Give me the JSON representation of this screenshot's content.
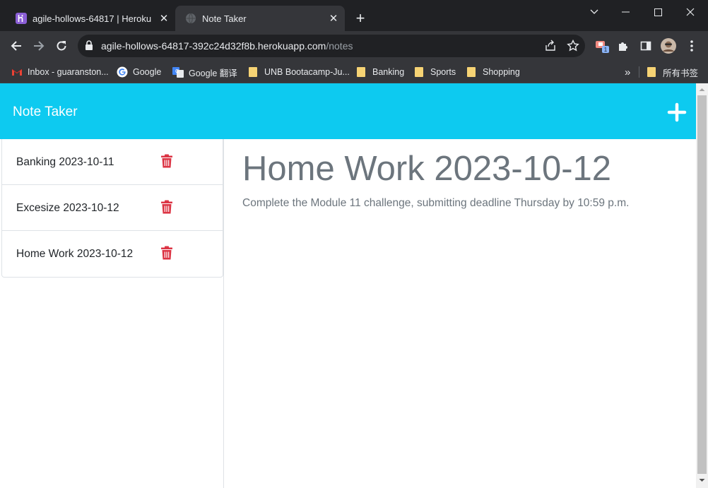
{
  "browser": {
    "tabs": [
      {
        "title": "agile-hollows-64817 | Heroku",
        "active": false
      },
      {
        "title": "Note Taker",
        "active": true
      }
    ],
    "url_host": "agile-hollows-64817-392c24d32f8b.herokuapp.com",
    "url_path": "/notes",
    "profile_badge_count": "1",
    "bookmarks": [
      {
        "label": "Inbox - guaranston...",
        "icon": "gmail-icon"
      },
      {
        "label": "Google",
        "icon": "google-icon"
      },
      {
        "label": "Google 翻译",
        "icon": "google-translate-icon"
      },
      {
        "label": "UNB Bootacamp-Ju...",
        "icon": "folder-icon"
      },
      {
        "label": "Banking",
        "icon": "folder-icon"
      },
      {
        "label": "Sports",
        "icon": "folder-icon"
      },
      {
        "label": "Shopping",
        "icon": "folder-icon"
      }
    ],
    "bookmarks_overflow": "»",
    "other_bookmarks": "所有书签"
  },
  "app": {
    "brand": "Note Taker",
    "colors": {
      "navbar": "#0dcaf0",
      "trash": "#dc3545",
      "muted_text": "#6c757d"
    },
    "notes": [
      {
        "title": "Banking 2023-10-11"
      },
      {
        "title": "Excesize 2023-10-12"
      },
      {
        "title": "Home Work 2023-10-12"
      }
    ],
    "active_note": {
      "title": "Home Work 2023-10-12",
      "text": "Complete the Module 11 challenge, submitting deadline Thursday by 10:59 p.m."
    }
  }
}
